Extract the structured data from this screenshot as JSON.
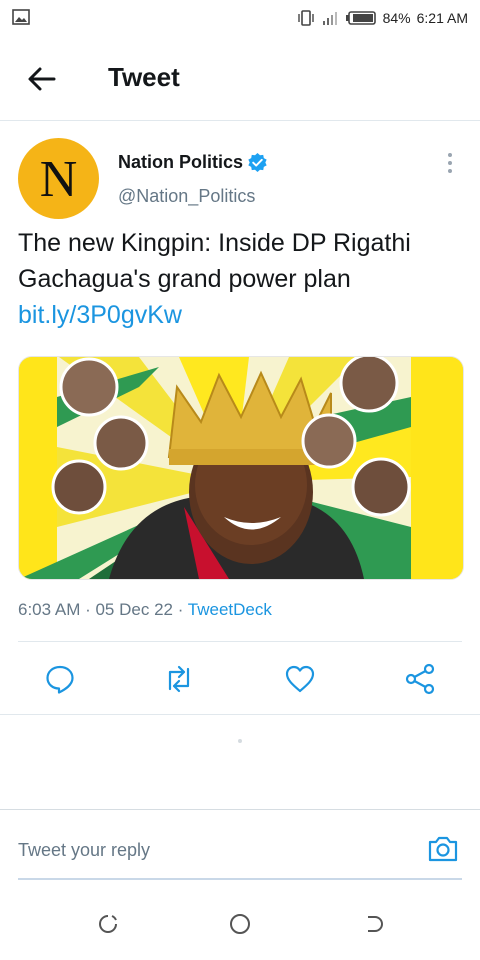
{
  "status_bar": {
    "battery": "84%",
    "time": "6:21 AM",
    "icons": [
      "gallery-icon",
      "vibrate-icon",
      "signal-icon",
      "battery-icon"
    ]
  },
  "header": {
    "title": "Tweet",
    "back_icon": "arrow-left-icon"
  },
  "tweet": {
    "avatar_letter": "N",
    "avatar_color": "#f5b417",
    "display_name": "Nation Politics",
    "verified": true,
    "handle": "@Nation_Politics",
    "text": "The new Kingpin: Inside DP Rigathi Gachagua's grand power plan",
    "link": "bit.ly/3P0gvKw",
    "timestamp": "6:03 AM · 05 Dec 22 · ",
    "source": "TweetDeck"
  },
  "actions": [
    "reply-icon",
    "retweet-icon",
    "like-icon",
    "share-icon"
  ],
  "reply": {
    "placeholder": "Tweet your reply"
  },
  "colors": {
    "link": "#1b95e0",
    "secondary_text": "#657786",
    "media_background": "#ffe51a"
  }
}
